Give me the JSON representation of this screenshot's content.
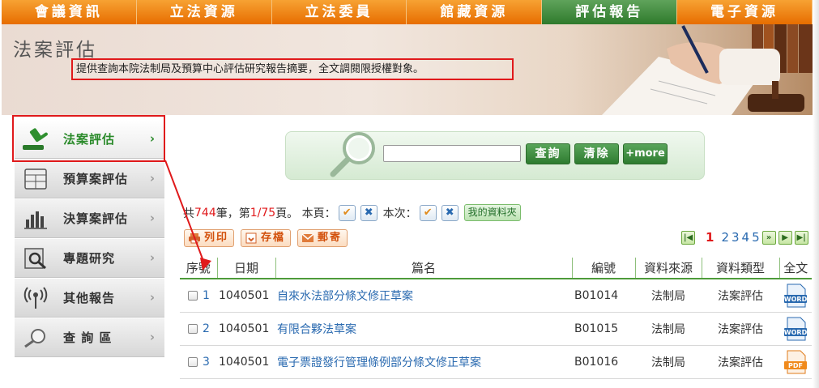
{
  "topnav": {
    "items": [
      {
        "label": "會議資訊",
        "active": false
      },
      {
        "label": "立法資源",
        "active": false
      },
      {
        "label": "立法委員",
        "active": false
      },
      {
        "label": "館藏資源",
        "active": false
      },
      {
        "label": "評估報告",
        "active": true
      },
      {
        "label": "電子資源",
        "active": false
      }
    ]
  },
  "banner": {
    "title": "法案評估",
    "description": "提供查詢本院法制局及預算中心評估研究報告摘要，全文調閱限授權對象。"
  },
  "sidebar": {
    "items": [
      {
        "label": "法案評估",
        "icon": "gavel-icon",
        "arrow": "›"
      },
      {
        "label": "預算案評估",
        "icon": "calculator-icon",
        "arrow": "›"
      },
      {
        "label": "決算案評估",
        "icon": "bar-chart-icon",
        "arrow": "›"
      },
      {
        "label": "專題研究",
        "icon": "magnifier-document-icon",
        "arrow": "›"
      },
      {
        "label": "其他報告",
        "icon": "broadcast-icon",
        "arrow": "›"
      },
      {
        "label": "查 詢 區",
        "icon": "search-icon",
        "arrow": "›"
      }
    ]
  },
  "search": {
    "query_btn": "查詢",
    "clear_btn": "清除",
    "more_btn": "+more",
    "value": ""
  },
  "results_info": {
    "prefix": "共",
    "total": "744",
    "mid1": "筆，第",
    "page": "1/75",
    "mid2": "頁。 本頁：",
    "this_time": "本次：",
    "folder_btn": "我的資料夾"
  },
  "tools": {
    "print": "列印",
    "save": "存檔",
    "mail": "郵寄"
  },
  "pager": {
    "current": "1",
    "pages": [
      "2",
      "3",
      "4",
      "5"
    ]
  },
  "table": {
    "headers": [
      "序號",
      "日期",
      "篇名",
      "編號",
      "資料來源",
      "資料類型",
      "全文"
    ],
    "rows": [
      {
        "seq": "1",
        "date": "1040501",
        "title": "自來水法部分條文修正草案",
        "code": "B01014",
        "source": "法制局",
        "type": "法案評估",
        "file": "word-icon",
        "file_label": "WORD"
      },
      {
        "seq": "2",
        "date": "1040501",
        "title": "有限合夥法草案",
        "code": "B01015",
        "source": "法制局",
        "type": "法案評估",
        "file": "word-icon",
        "file_label": "WORD"
      },
      {
        "seq": "3",
        "date": "1040501",
        "title": "電子票證發行管理條例部分條文修正草案",
        "code": "B01016",
        "source": "法制局",
        "type": "法案評估",
        "file": "pdf-icon",
        "file_label": "PDF"
      }
    ]
  },
  "colors": {
    "nav_orange": "#e76d00",
    "nav_active_green": "#2f7a2c",
    "highlight_red": "#e0191b",
    "link_blue": "#2a6ab0"
  }
}
